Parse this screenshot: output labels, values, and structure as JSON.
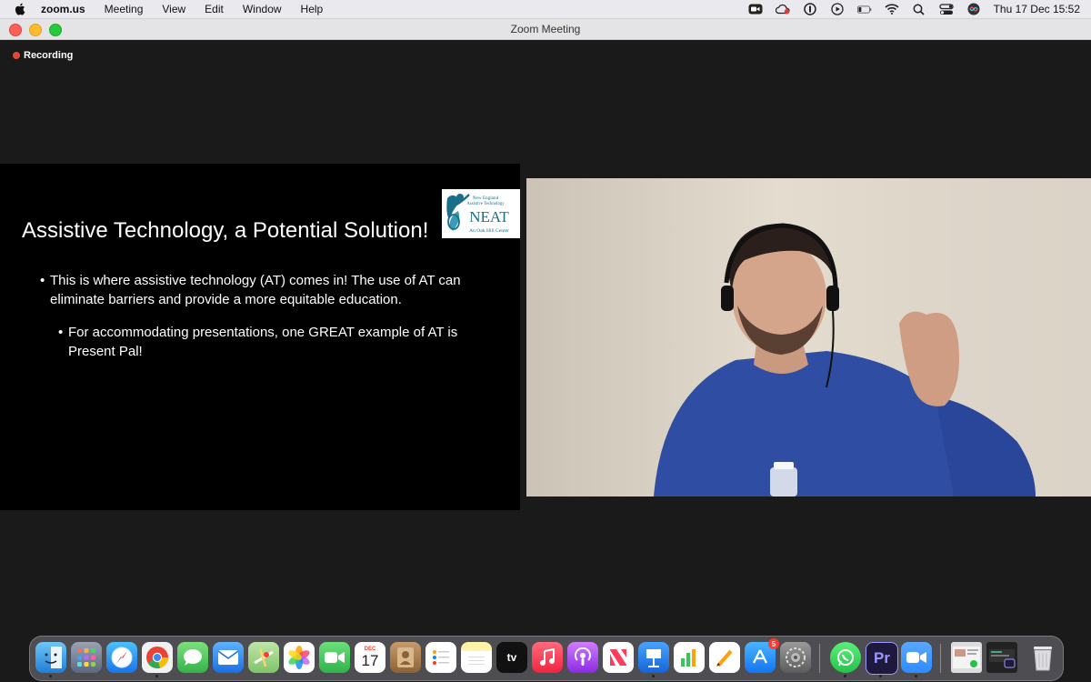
{
  "menubar": {
    "app_name": "zoom.us",
    "menus": [
      "Meeting",
      "View",
      "Edit",
      "Window",
      "Help"
    ],
    "clock": "Thu 17 Dec  15:52"
  },
  "window": {
    "title": "Zoom Meeting"
  },
  "recording": {
    "label": "Recording"
  },
  "slide": {
    "title": "Assistive Technology, a Potential Solution!",
    "bullets": [
      {
        "text": "This is where assistive technology (AT) comes in! The use of AT can eliminate barriers and provide a more equitable education."
      },
      {
        "text": "For accommodating presentations, one GREAT example of AT is Present Pal!"
      }
    ],
    "logo": {
      "line1": "New England",
      "line2": "Assistive Technology",
      "name": "NEAT",
      "tagline": "An Oak Hill Center"
    }
  },
  "dock": {
    "calendar_month": "DEC",
    "calendar_day": "17",
    "appletv_label": "tv",
    "appstore_badge": "5",
    "premiere_label": "Pr"
  },
  "colors": {
    "recording_dot": "#e6453a",
    "slide_bg": "#000000",
    "meeting_bg": "#1a1a1a",
    "logo_teal": "#1a6e8a"
  }
}
